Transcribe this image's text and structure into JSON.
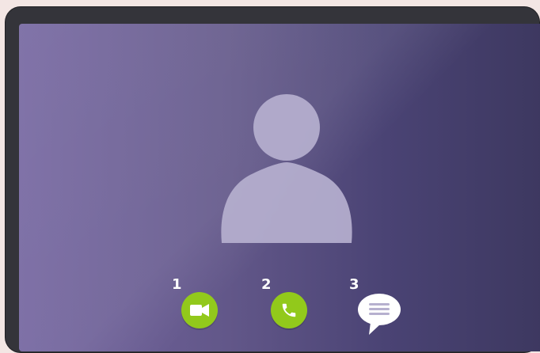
{
  "controls": {
    "video": {
      "number": "1",
      "icon": "video-camera-icon",
      "color": "#92c91b"
    },
    "voice": {
      "number": "2",
      "icon": "phone-icon",
      "color": "#92c91b"
    },
    "message": {
      "number": "3",
      "icon": "chat-bubble-icon",
      "color": "#ffffff"
    }
  },
  "theme": {
    "screen_gradient_left": "#73649f",
    "screen_gradient_right": "#3d3860",
    "avatar_color": "#b6b0cf",
    "accent_green": "#92c91b"
  }
}
